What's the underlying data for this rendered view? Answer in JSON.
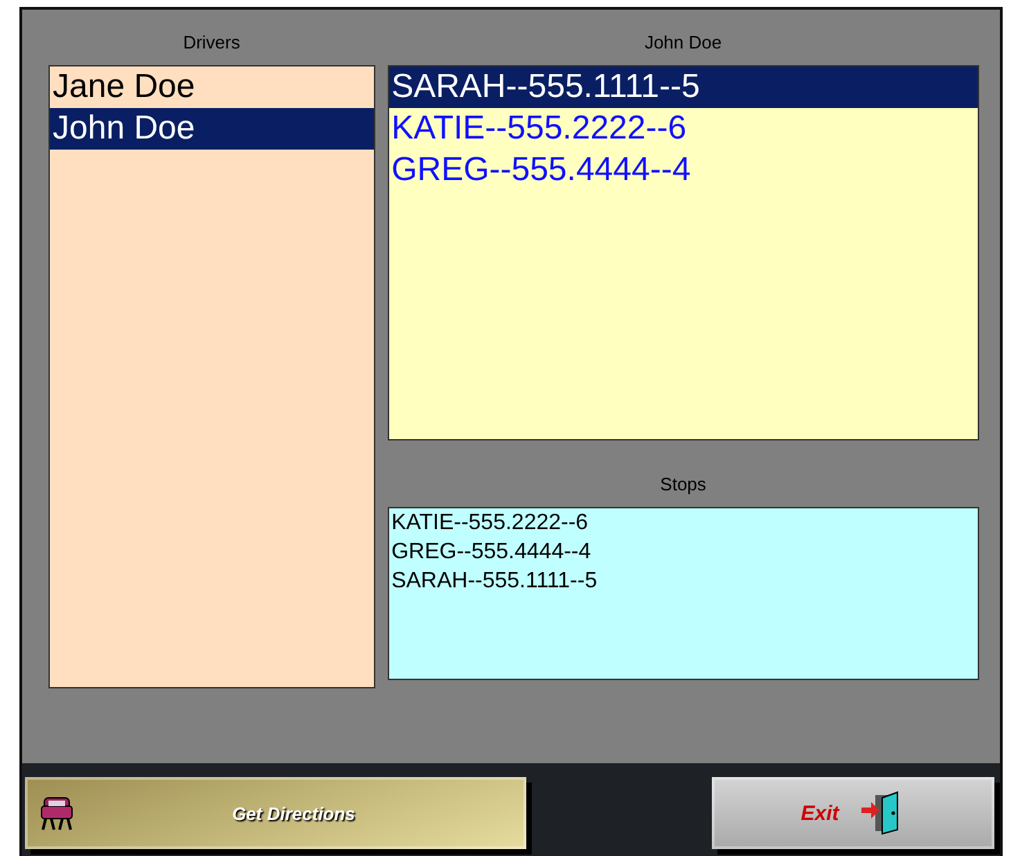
{
  "drivers": {
    "title": "Drivers",
    "items": [
      {
        "label": "Jane Doe",
        "selected": false
      },
      {
        "label": "John Doe",
        "selected": true
      }
    ]
  },
  "route": {
    "title": "John Doe",
    "items": [
      {
        "label": "SARAH--555.1111--5",
        "selected": true
      },
      {
        "label": "KATIE--555.2222--6",
        "selected": false
      },
      {
        "label": "GREG--555.4444--4",
        "selected": false
      }
    ]
  },
  "stops": {
    "title": "Stops",
    "items": [
      "KATIE--555.2222--6",
      "GREG--555.4444--4",
      "SARAH--555.1111--5"
    ]
  },
  "buttons": [
    {
      "kind": "directions",
      "label": "Get Directions"
    },
    {
      "kind": "exit",
      "label": "Exit"
    }
  ]
}
